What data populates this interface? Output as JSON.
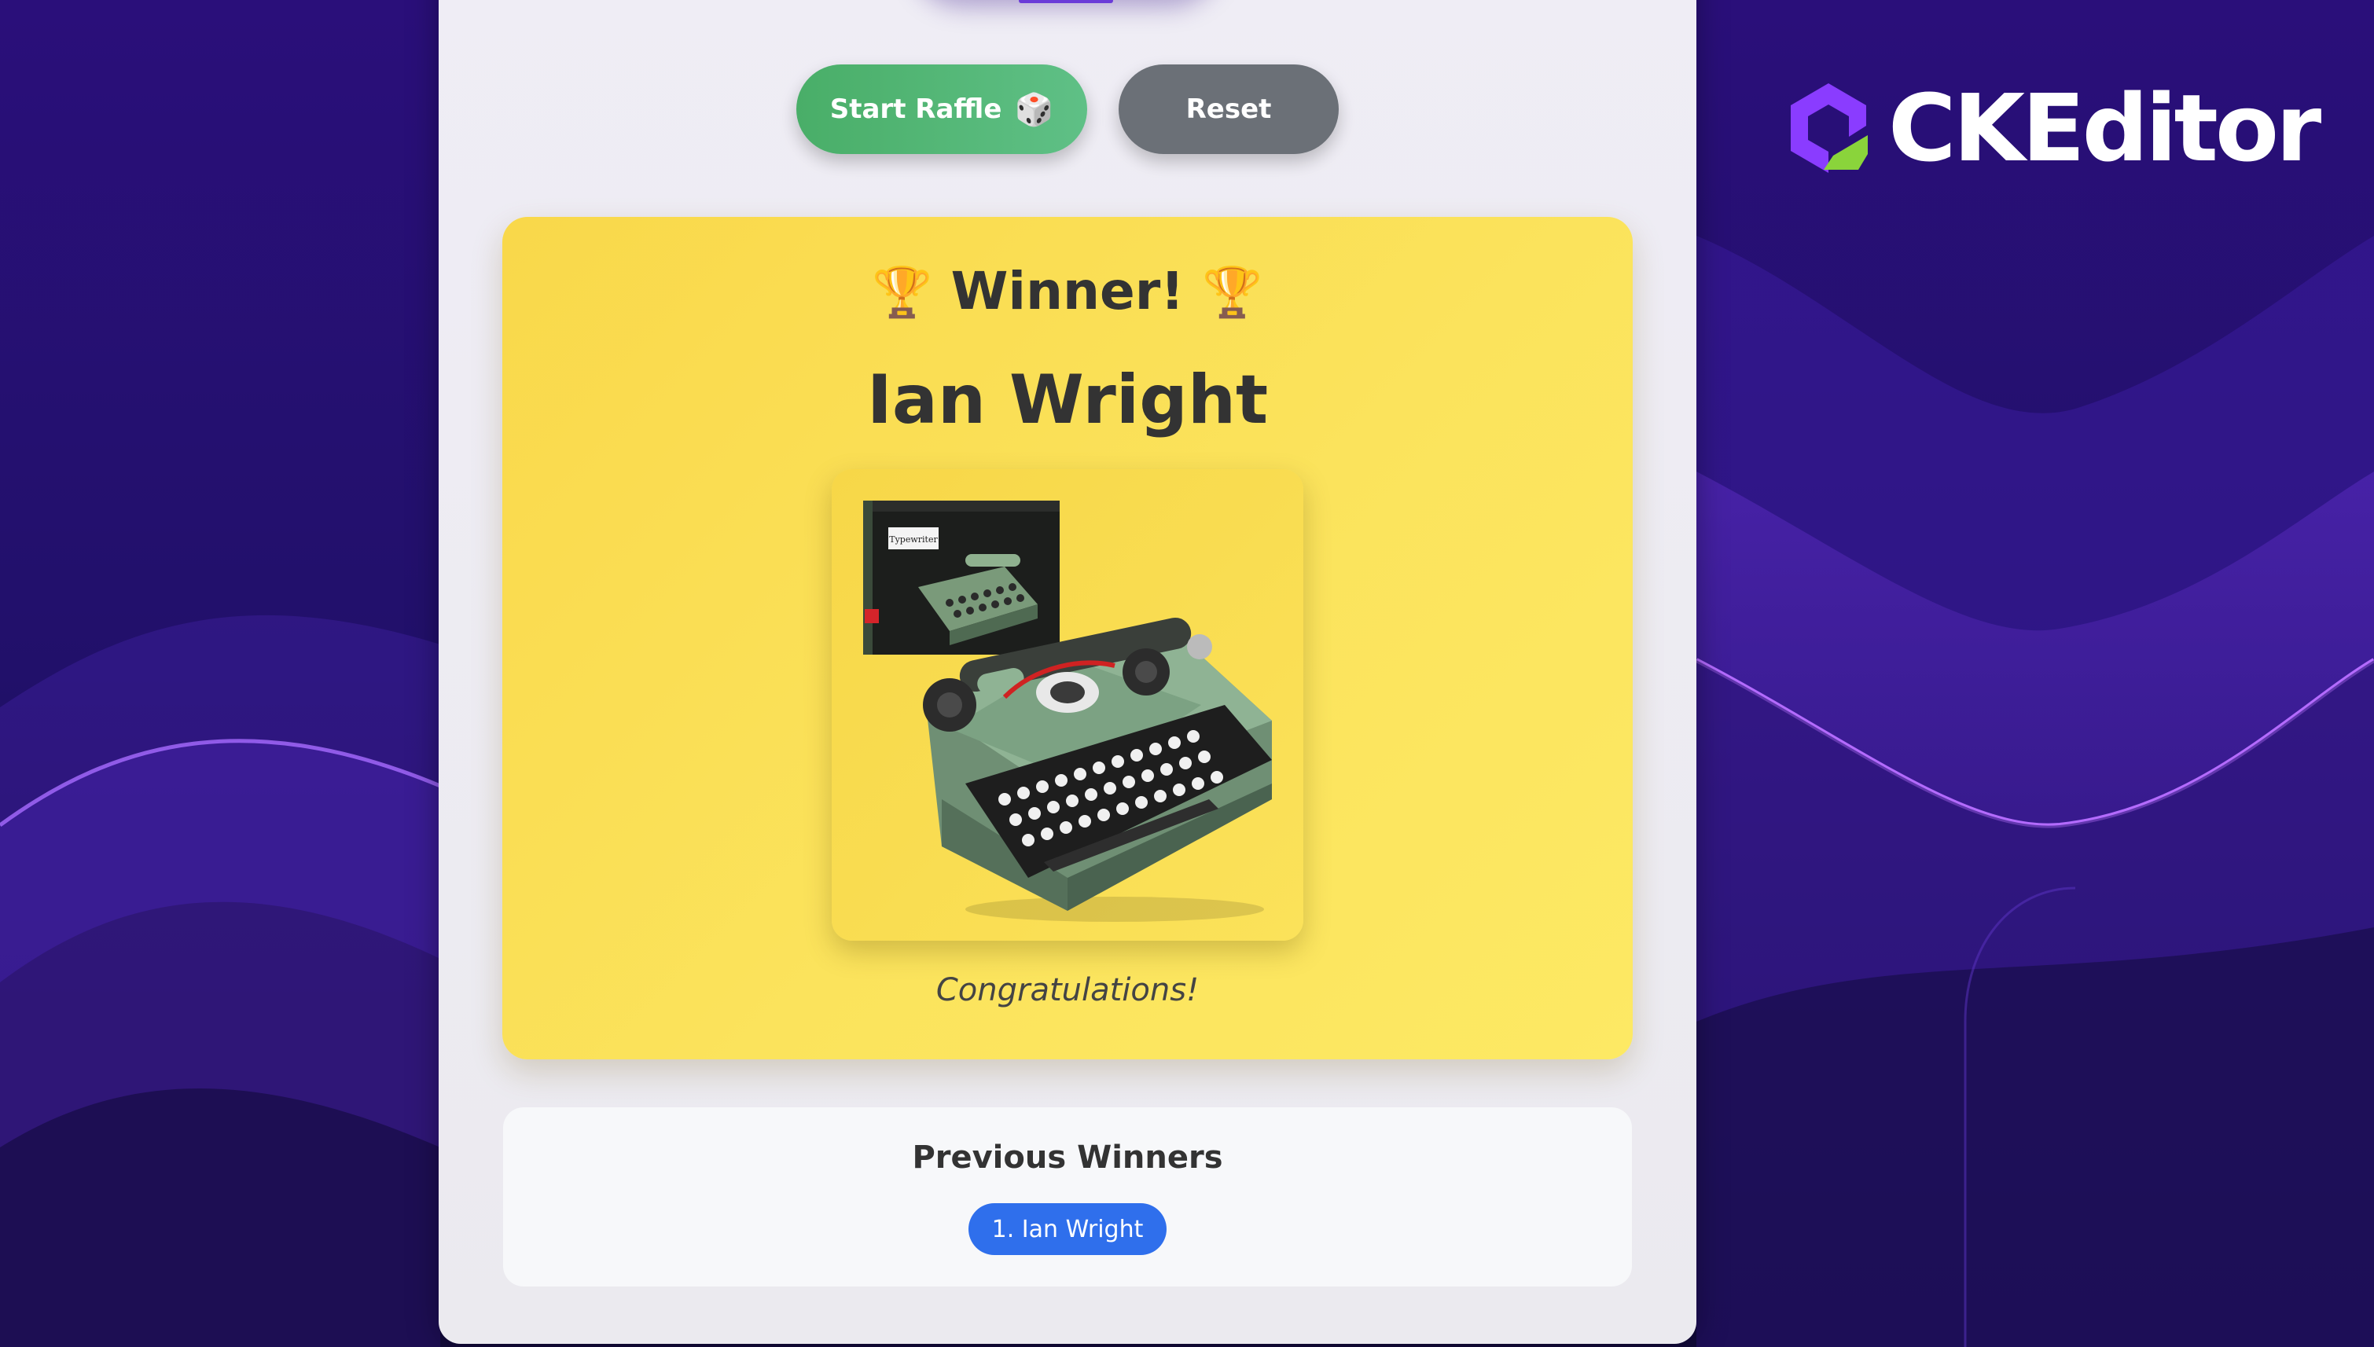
{
  "brand": {
    "name": "CKEditor",
    "logo_icon": "ckeditor-logo-icon"
  },
  "colors": {
    "background_purple": "#1c0c52",
    "accent_violet": "#a24dff",
    "start_button_green": "#4cb46e",
    "reset_button_gray": "#6b7077",
    "winner_card_yellow": "#fbe25a",
    "chip_blue": "#2f6fec"
  },
  "controls": {
    "start_label": "Start Raffle",
    "start_icon": "🎲",
    "reset_label": "Reset"
  },
  "winner": {
    "trophy_icon": "🏆",
    "heading": "Winner!",
    "name": "Ian Wright",
    "prize_image": "typewriter-prize-image",
    "prize_box_label": "Typewriter",
    "message": "Congratulations!"
  },
  "previous_winners": {
    "title": "Previous Winners",
    "items": [
      {
        "label": "1. Ian Wright"
      }
    ]
  }
}
